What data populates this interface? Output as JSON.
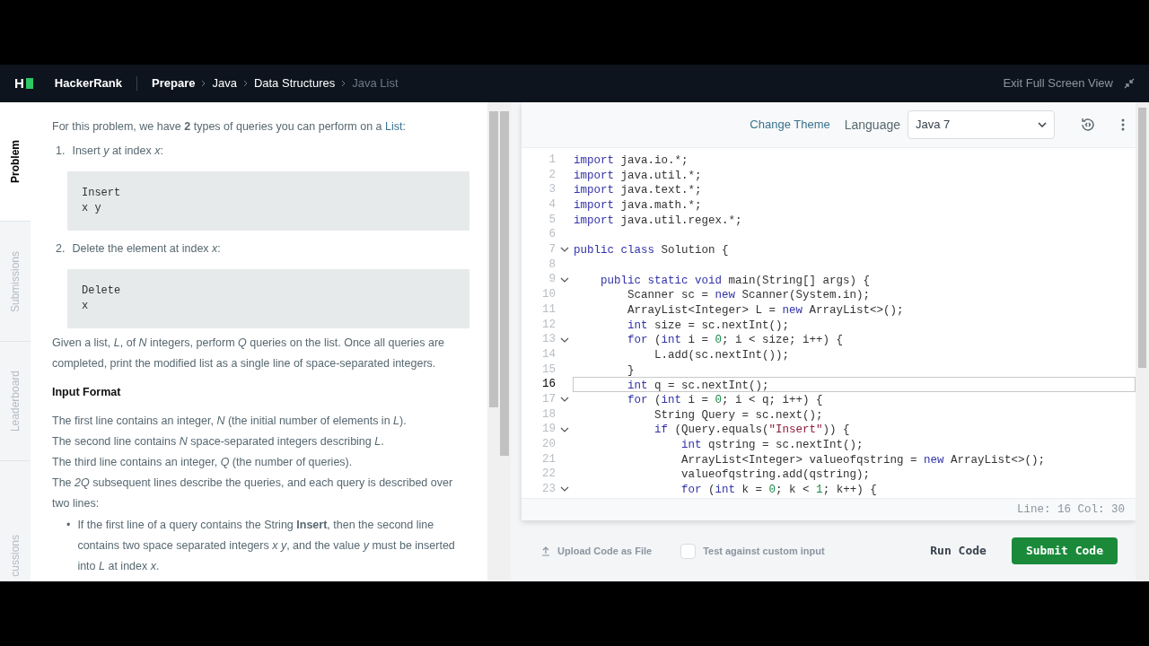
{
  "nav": {
    "logo": "H",
    "brand": "HackerRank",
    "breadcrumbs": [
      {
        "label": "Prepare",
        "current": false,
        "bold": true
      },
      {
        "label": "Java",
        "current": false,
        "bold": false
      },
      {
        "label": "Data Structures",
        "current": false,
        "bold": false
      },
      {
        "label": "Java List",
        "current": true,
        "bold": false
      }
    ],
    "exit_full_screen": "Exit Full Screen View"
  },
  "side_tabs": [
    {
      "label": "Problem",
      "selected": true
    },
    {
      "label": "Submissions",
      "selected": false
    },
    {
      "label": "Leaderboard",
      "selected": false
    },
    {
      "label": "cussions",
      "selected": false
    }
  ],
  "problem": {
    "blocks": [
      {
        "kind": "paragraph",
        "text": "For this problem, we have **2** types of queries you can perform on a ",
        "link": "List",
        "after": ":"
      },
      {
        "kind": "item",
        "marker": "1.",
        "text": "Insert *y* at index *x*:"
      },
      {
        "kind": "code",
        "lines": [
          "Insert",
          "x y"
        ]
      },
      {
        "kind": "item",
        "marker": "2.",
        "text": "Delete the element at index *x*:"
      },
      {
        "kind": "code",
        "lines": [
          "Delete",
          "x"
        ]
      },
      {
        "kind": "paragraph",
        "text": "Given a list, *L*, of *N* integers, perform *Q* queries on the list. Once all queries are completed, print the modified list as a single line of space-separated integers."
      },
      {
        "kind": "heading",
        "text": "Input Format"
      },
      {
        "kind": "line",
        "text": "The first line contains an integer, *N* (the initial number of elements in *L*)."
      },
      {
        "kind": "line",
        "text": "The second line contains *N* space-separated integers describing *L*."
      },
      {
        "kind": "line",
        "text": "The third line contains an integer, *Q* (the number of queries)."
      },
      {
        "kind": "line",
        "text": "The *2Q* subsequent lines describe the queries, and each query is described over two lines:"
      },
      {
        "kind": "bullet",
        "marker": "•",
        "text": "If the first line of a query contains the String **Insert**, then the second line contains two space separated integers *x* *y*, and the value *y* must be inserted into *L* at index *x*."
      }
    ]
  },
  "editor": {
    "change_theme": "Change Theme",
    "language_label": "Language",
    "language": "Java 7",
    "lines": [
      {
        "number": "1",
        "fold": false,
        "current": false,
        "tokens": [
          {
            "kind": "kw",
            "text": "import"
          },
          {
            "kind": "plain",
            "text": " java.io.*;"
          }
        ]
      },
      {
        "number": "2",
        "fold": false,
        "current": false,
        "tokens": [
          {
            "kind": "kw",
            "text": "import"
          },
          {
            "kind": "plain",
            "text": " java.util.*;"
          }
        ]
      },
      {
        "number": "3",
        "fold": false,
        "current": false,
        "tokens": [
          {
            "kind": "kw",
            "text": "import"
          },
          {
            "kind": "plain",
            "text": " java.text.*;"
          }
        ]
      },
      {
        "number": "4",
        "fold": false,
        "current": false,
        "tokens": [
          {
            "kind": "kw",
            "text": "import"
          },
          {
            "kind": "plain",
            "text": " java.math.*;"
          }
        ]
      },
      {
        "number": "5",
        "fold": false,
        "current": false,
        "tokens": [
          {
            "kind": "kw",
            "text": "import"
          },
          {
            "kind": "plain",
            "text": " java.util.regex.*;"
          }
        ]
      },
      {
        "number": "6",
        "fold": false,
        "current": false
      },
      {
        "number": "7",
        "fold": true,
        "current": false,
        "tokens": [
          {
            "kind": "kw",
            "text": "public class"
          },
          {
            "kind": "plain",
            "text": " Solution {"
          }
        ]
      },
      {
        "number": "8",
        "fold": false,
        "current": false
      },
      {
        "number": "9",
        "fold": true,
        "current": false,
        "tokens": [
          {
            "kind": "kw",
            "text": "    public static void"
          },
          {
            "kind": "plain",
            "text": " main(String[] args) {"
          }
        ]
      },
      {
        "number": "10",
        "fold": false,
        "current": false,
        "tokens": [
          {
            "kind": "plain",
            "text": "        Scanner sc = "
          },
          {
            "kind": "kw",
            "text": "new"
          },
          {
            "kind": "plain",
            "text": " Scanner(System.in);"
          }
        ]
      },
      {
        "number": "11",
        "fold": false,
        "current": false,
        "tokens": [
          {
            "kind": "plain",
            "text": "        ArrayList<Integer> L = "
          },
          {
            "kind": "kw",
            "text": "new"
          },
          {
            "kind": "plain",
            "text": " ArrayList<>();"
          }
        ]
      },
      {
        "number": "12",
        "fold": false,
        "current": false,
        "tokens": [
          {
            "kind": "kw",
            "text": "        int"
          },
          {
            "kind": "plain",
            "text": " size = sc.nextInt();"
          }
        ]
      },
      {
        "number": "13",
        "fold": true,
        "current": false,
        "tokens": [
          {
            "kind": "kw",
            "text": "        for"
          },
          {
            "kind": "plain",
            "text": " ("
          },
          {
            "kind": "kw",
            "text": "int"
          },
          {
            "kind": "plain",
            "text": " i = "
          },
          {
            "kind": "num",
            "text": "0"
          },
          {
            "kind": "plain",
            "text": "; i < size; i++) {"
          }
        ]
      },
      {
        "number": "14",
        "fold": false,
        "current": false,
        "tokens": [
          {
            "kind": "plain",
            "text": "            L.add(sc.nextInt());"
          }
        ]
      },
      {
        "number": "15",
        "fold": false,
        "current": false,
        "tokens": [
          {
            "kind": "plain",
            "text": "        }"
          }
        ]
      },
      {
        "number": "16",
        "fold": false,
        "current": true,
        "tokens": [
          {
            "kind": "kw",
            "text": "        int"
          },
          {
            "kind": "plain",
            "text": " q = sc.nextInt();"
          }
        ]
      },
      {
        "number": "17",
        "fold": true,
        "current": false,
        "tokens": [
          {
            "kind": "kw",
            "text": "        for"
          },
          {
            "kind": "plain",
            "text": " ("
          },
          {
            "kind": "kw",
            "text": "int"
          },
          {
            "kind": "plain",
            "text": " i = "
          },
          {
            "kind": "num",
            "text": "0"
          },
          {
            "kind": "plain",
            "text": "; i < q; i++) {"
          }
        ]
      },
      {
        "number": "18",
        "fold": false,
        "current": false,
        "tokens": [
          {
            "kind": "plain",
            "text": "            String Query = sc.next();"
          }
        ]
      },
      {
        "number": "19",
        "fold": true,
        "current": false,
        "tokens": [
          {
            "kind": "kw",
            "text": "            if"
          },
          {
            "kind": "plain",
            "text": " (Query.equals("
          },
          {
            "kind": "str",
            "text": "\"Insert\""
          },
          {
            "kind": "plain",
            "text": ")) {"
          }
        ]
      },
      {
        "number": "20",
        "fold": false,
        "current": false,
        "tokens": [
          {
            "kind": "kw",
            "text": "                int"
          },
          {
            "kind": "plain",
            "text": " qstring = sc.nextInt();"
          }
        ]
      },
      {
        "number": "21",
        "fold": false,
        "current": false,
        "tokens": [
          {
            "kind": "plain",
            "text": "                ArrayList<Integer> valueofqstring = "
          },
          {
            "kind": "kw",
            "text": "new"
          },
          {
            "kind": "plain",
            "text": " ArrayList<>();"
          }
        ]
      },
      {
        "number": "22",
        "fold": false,
        "current": false,
        "tokens": [
          {
            "kind": "plain",
            "text": "                valueofqstring.add(qstring);"
          }
        ]
      },
      {
        "number": "23",
        "fold": true,
        "current": false,
        "tokens": [
          {
            "kind": "kw",
            "text": "                for"
          },
          {
            "kind": "plain",
            "text": " ("
          },
          {
            "kind": "kw",
            "text": "int"
          },
          {
            "kind": "plain",
            "text": " k = "
          },
          {
            "kind": "num",
            "text": "0"
          },
          {
            "kind": "plain",
            "text": "; k < "
          },
          {
            "kind": "num",
            "text": "1"
          },
          {
            "kind": "plain",
            "text": "; k++) {"
          }
        ]
      }
    ],
    "status": "Line: 16 Col: 30"
  },
  "footer": {
    "upload": "Upload Code as File",
    "custom_input": {
      "label": "Test against custom input",
      "checked": false
    },
    "run": "Run Code",
    "submit": "Submit Code"
  }
}
